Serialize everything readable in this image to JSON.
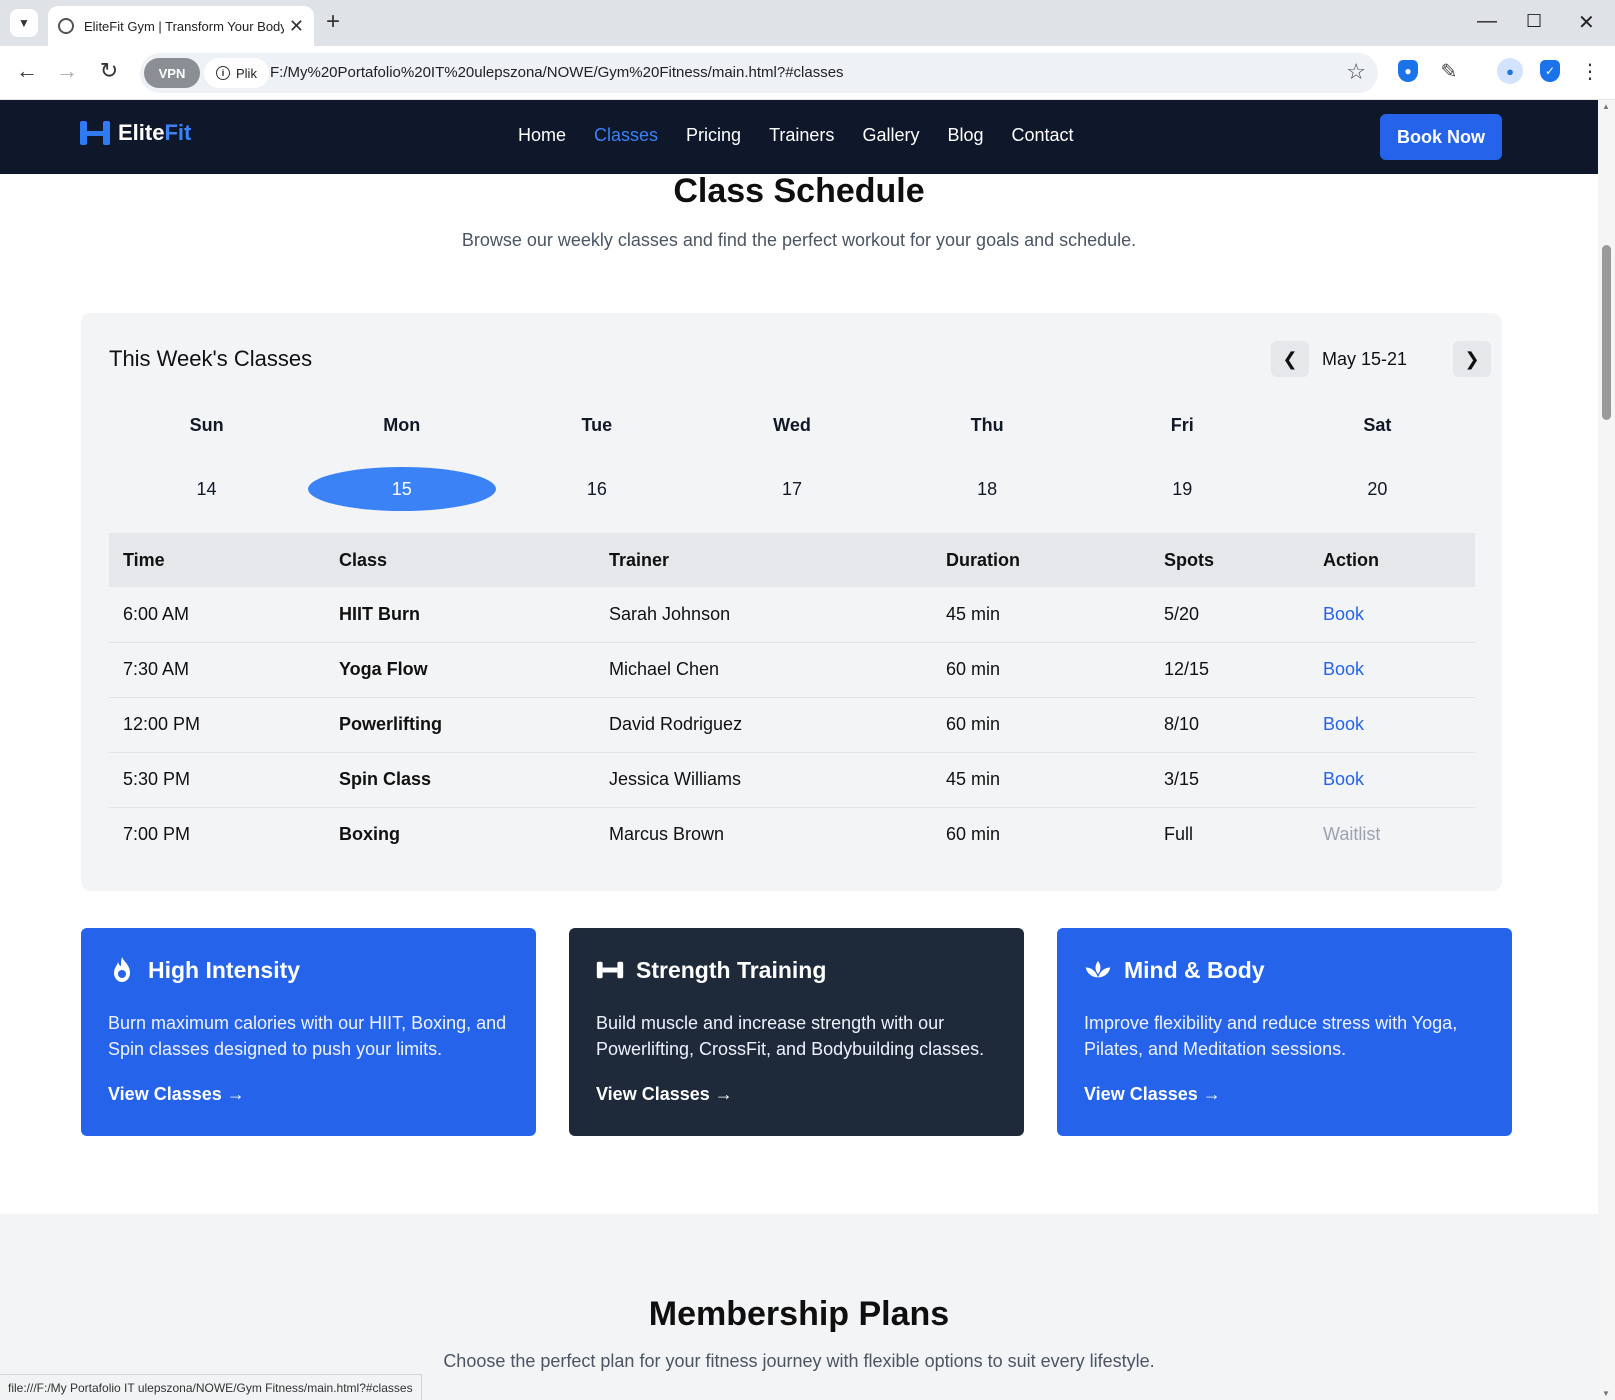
{
  "browser": {
    "tab_title": "EliteFit Gym | Transform Your Body",
    "url": "F:/My%20Portafolio%20IT%20ulepszona/NOWE/Gym%20Fitness/main.html?#classes",
    "vpn_label": "VPN",
    "site_chip_label": "Plik",
    "status_url": "file:///F:/My Portafolio IT ulepszona/NOWE/Gym Fitness/main.html?#classes"
  },
  "header": {
    "logo_main": "Elite",
    "logo_accent": "Fit",
    "nav": [
      "Home",
      "Classes",
      "Pricing",
      "Trainers",
      "Gallery",
      "Blog",
      "Contact"
    ],
    "active_nav": "Classes",
    "cta": "Book Now",
    "accent_color": "#3b82f6"
  },
  "schedule": {
    "title": "Class Schedule",
    "subtitle": "Browse our weekly classes and find the perfect workout for your goals and schedule.",
    "week_title": "This Week's Classes",
    "week_range": "May 15-21",
    "days": [
      {
        "name": "Sun",
        "num": "14"
      },
      {
        "name": "Mon",
        "num": "15"
      },
      {
        "name": "Tue",
        "num": "16"
      },
      {
        "name": "Wed",
        "num": "17"
      },
      {
        "name": "Thu",
        "num": "18"
      },
      {
        "name": "Fri",
        "num": "19"
      },
      {
        "name": "Sat",
        "num": "20"
      }
    ],
    "selected_day": "15",
    "columns": [
      "Time",
      "Class",
      "Trainer",
      "Duration",
      "Spots",
      "Action"
    ],
    "rows": [
      {
        "time": "6:00 AM",
        "class": "HIIT Burn",
        "trainer": "Sarah Johnson",
        "duration": "45 min",
        "spots": "5/20",
        "action": "Book"
      },
      {
        "time": "7:30 AM",
        "class": "Yoga Flow",
        "trainer": "Michael Chen",
        "duration": "60 min",
        "spots": "12/15",
        "action": "Book"
      },
      {
        "time": "12:00 PM",
        "class": "Powerlifting",
        "trainer": "David Rodriguez",
        "duration": "60 min",
        "spots": "8/10",
        "action": "Book"
      },
      {
        "time": "5:30 PM",
        "class": "Spin Class",
        "trainer": "Jessica Williams",
        "duration": "45 min",
        "spots": "3/15",
        "action": "Book"
      },
      {
        "time": "7:00 PM",
        "class": "Boxing",
        "trainer": "Marcus Brown",
        "duration": "60 min",
        "spots": "Full",
        "action": "Waitlist"
      }
    ]
  },
  "features": [
    {
      "icon": "flame-icon",
      "title": "High Intensity",
      "desc": "Burn maximum calories with our HIIT, Boxing, and Spin classes designed to push your limits.",
      "link": "View Classes →",
      "color": "#2563eb"
    },
    {
      "icon": "dumbbell-icon",
      "title": "Strength Training",
      "desc": "Build muscle and increase strength with our Powerlifting, CrossFit, and Bodybuilding classes.",
      "link": "View Classes →",
      "color": "#1e2939"
    },
    {
      "icon": "lotus-icon",
      "title": "Mind & Body",
      "desc": "Improve flexibility and reduce stress with Yoga, Pilates, and Meditation sessions.",
      "link": "View Classes →",
      "color": "#2563eb"
    }
  ],
  "membership": {
    "title": "Membership Plans",
    "subtitle": "Choose the perfect plan for your fitness journey with flexible options to suit every lifestyle."
  }
}
